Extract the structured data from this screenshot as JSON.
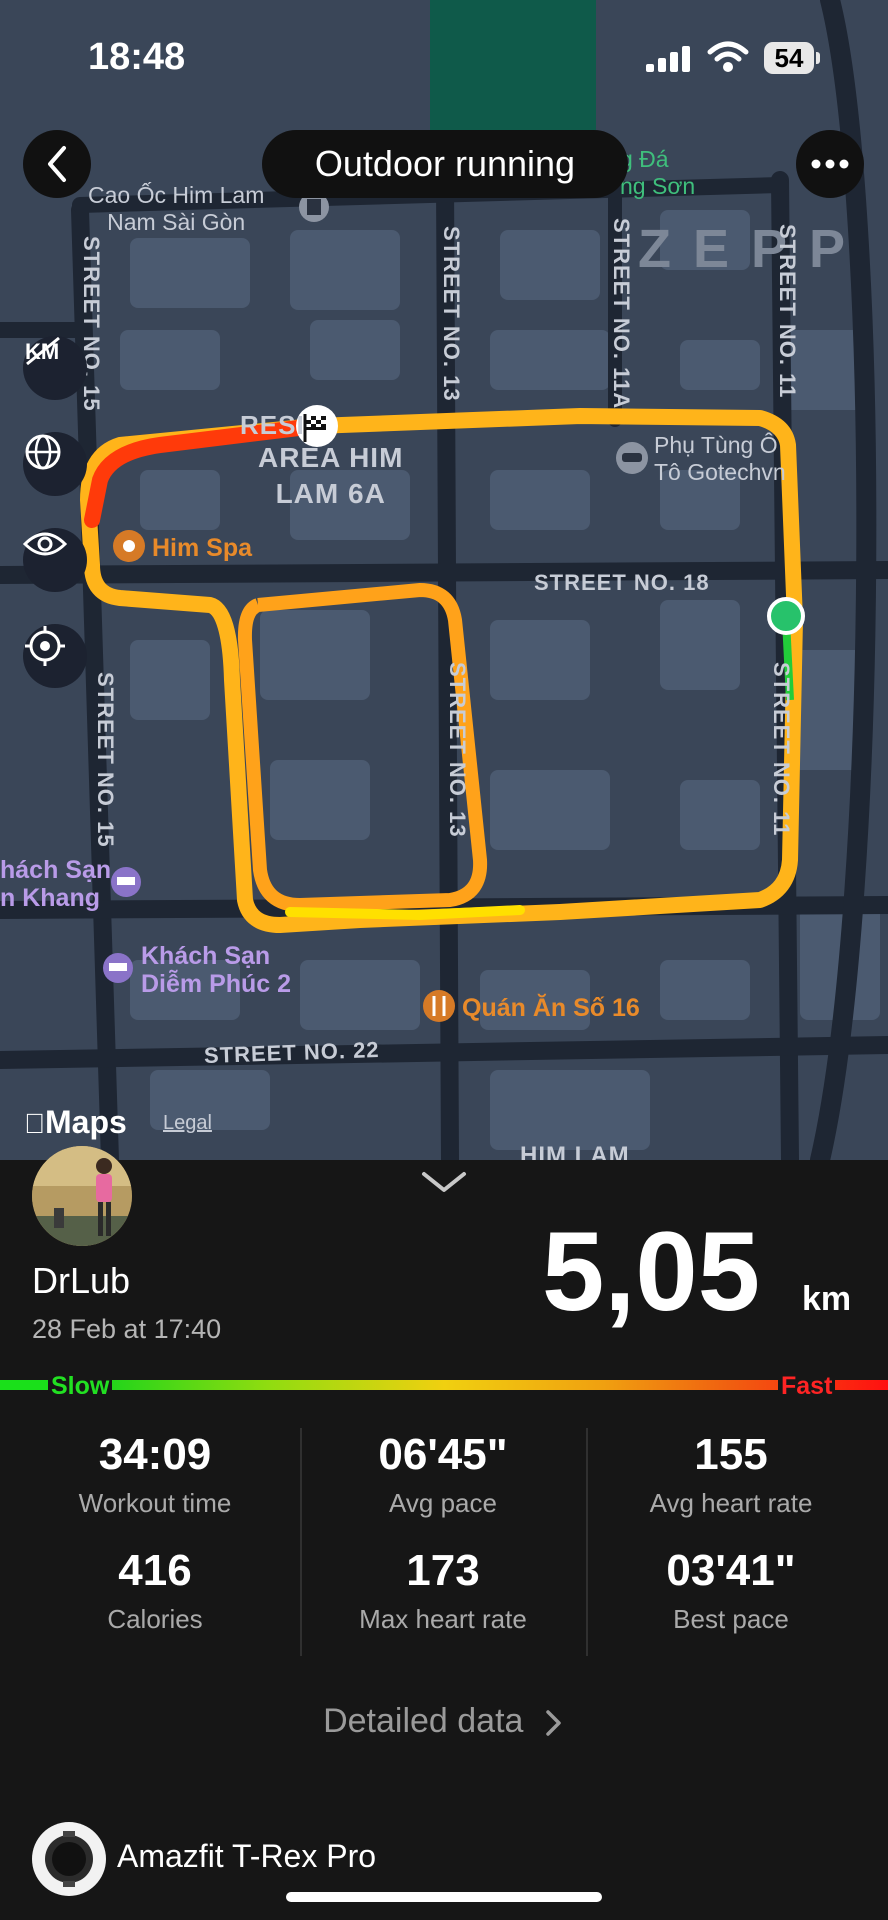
{
  "status_bar": {
    "time": "18:48",
    "battery": "54"
  },
  "header": {
    "title": "Outdoor running"
  },
  "map": {
    "streets": {
      "s15_top": "STREET NO. 15",
      "s15_bottom": "STREET NO. 15",
      "s13_top": "STREET NO. 13",
      "s13_mid": "STREET NO. 13",
      "s11a": "STREET NO. 11A",
      "s11_top": "STREET NO. 11",
      "s11_mid": "STREET NO. 11",
      "s18": "STREET NO. 18",
      "s22": "STREET NO. 22"
    },
    "pois": {
      "cao_oc": "Cao Ốc Him Lam\nNam Sài Gòn",
      "bong_da": "g Đá\nng Sơn",
      "phu_tung": "Phụ Tùng Ô\nTô Gotechvn",
      "him_spa": "Him Spa",
      "khach_san_1": "hách Sạn\nn Khang",
      "khach_san_2": "Khách Sạn\nDiễm Phúc 2",
      "quan_an": "Quán Ăn Số 16",
      "area": "AREA HIM\nLAM 6A",
      "resi": "RESI",
      "him_lam_bottom": "HIM LAM"
    },
    "watermark": "ZEPP",
    "attribution": "Maps",
    "legal": "Legal"
  },
  "summary": {
    "user_name": "DrLub",
    "date": "28 Feb at 17:40",
    "distance_value": "5,05",
    "distance_unit": "km",
    "pace_slow_label": "Slow",
    "pace_fast_label": "Fast"
  },
  "stats": [
    {
      "value": "34:09",
      "label": "Workout time"
    },
    {
      "value": "06'45\"",
      "label": "Avg pace"
    },
    {
      "value": "155",
      "label": "Avg heart rate"
    },
    {
      "value": "416",
      "label": "Calories"
    },
    {
      "value": "173",
      "label": "Max heart rate"
    },
    {
      "value": "03'41\"",
      "label": "Best pace"
    }
  ],
  "detailed_link": "Detailed data",
  "device": {
    "name": "Amazfit T-Rex Pro"
  },
  "colors": {
    "route_fast": "#ff2a0a",
    "route_mid": "#ffb01a",
    "route_slow": "#ffe000",
    "start_point": "#27c26b",
    "map_bg": "#3a4658",
    "panel_bg": "#161616"
  }
}
